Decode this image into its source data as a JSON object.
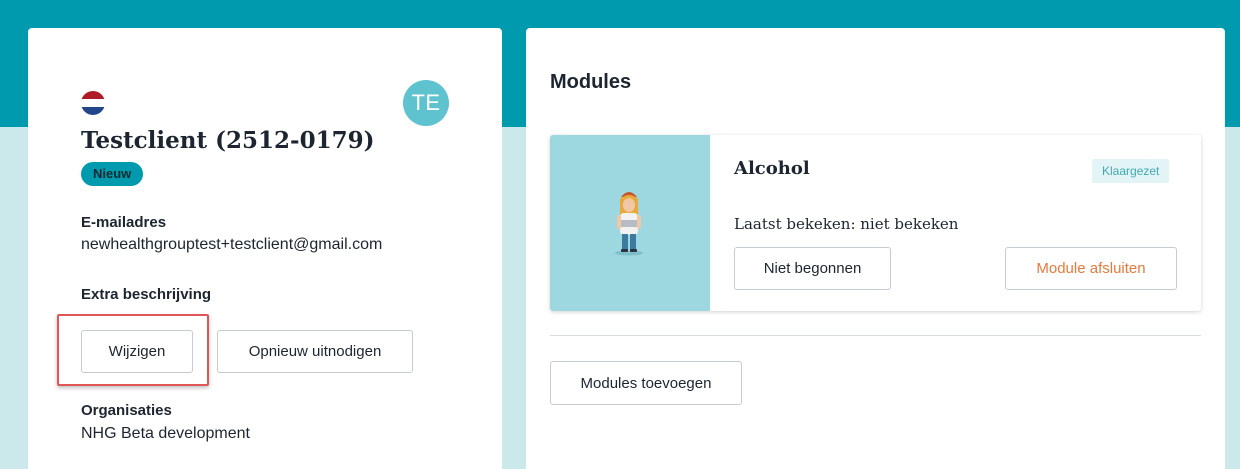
{
  "client": {
    "flag_icon": "netherlands-flag-icon",
    "avatar_initials": "TE",
    "name": "Testclient (2512-0179)",
    "status_badge": "Nieuw",
    "email_label": "E-mailadres",
    "email_value": "newhealthgrouptest+testclient@gmail.com",
    "extra_description_label": "Extra beschrijving",
    "edit_button": "Wijzigen",
    "reinvite_button": "Opnieuw uitnodigen",
    "organisations_label": "Organisaties",
    "organisations_value": "NHG Beta development"
  },
  "modules": {
    "title": "Modules",
    "items": [
      {
        "name": "Alcohol",
        "status": "Klaargezet",
        "last_viewed": "Laatst bekeken: niet bekeken",
        "progress_button": "Niet begonnen",
        "close_button": "Module afsluiten"
      }
    ],
    "add_button": "Modules toevoegen"
  },
  "colors": {
    "header_band": "#009aae",
    "page_background": "#cbe8ea",
    "badge_new": "#009aae",
    "avatar": "#5ec3cf",
    "module_image_bg": "#9dd7df",
    "close_module_text": "#e8793b",
    "highlight_border": "#e05656"
  }
}
